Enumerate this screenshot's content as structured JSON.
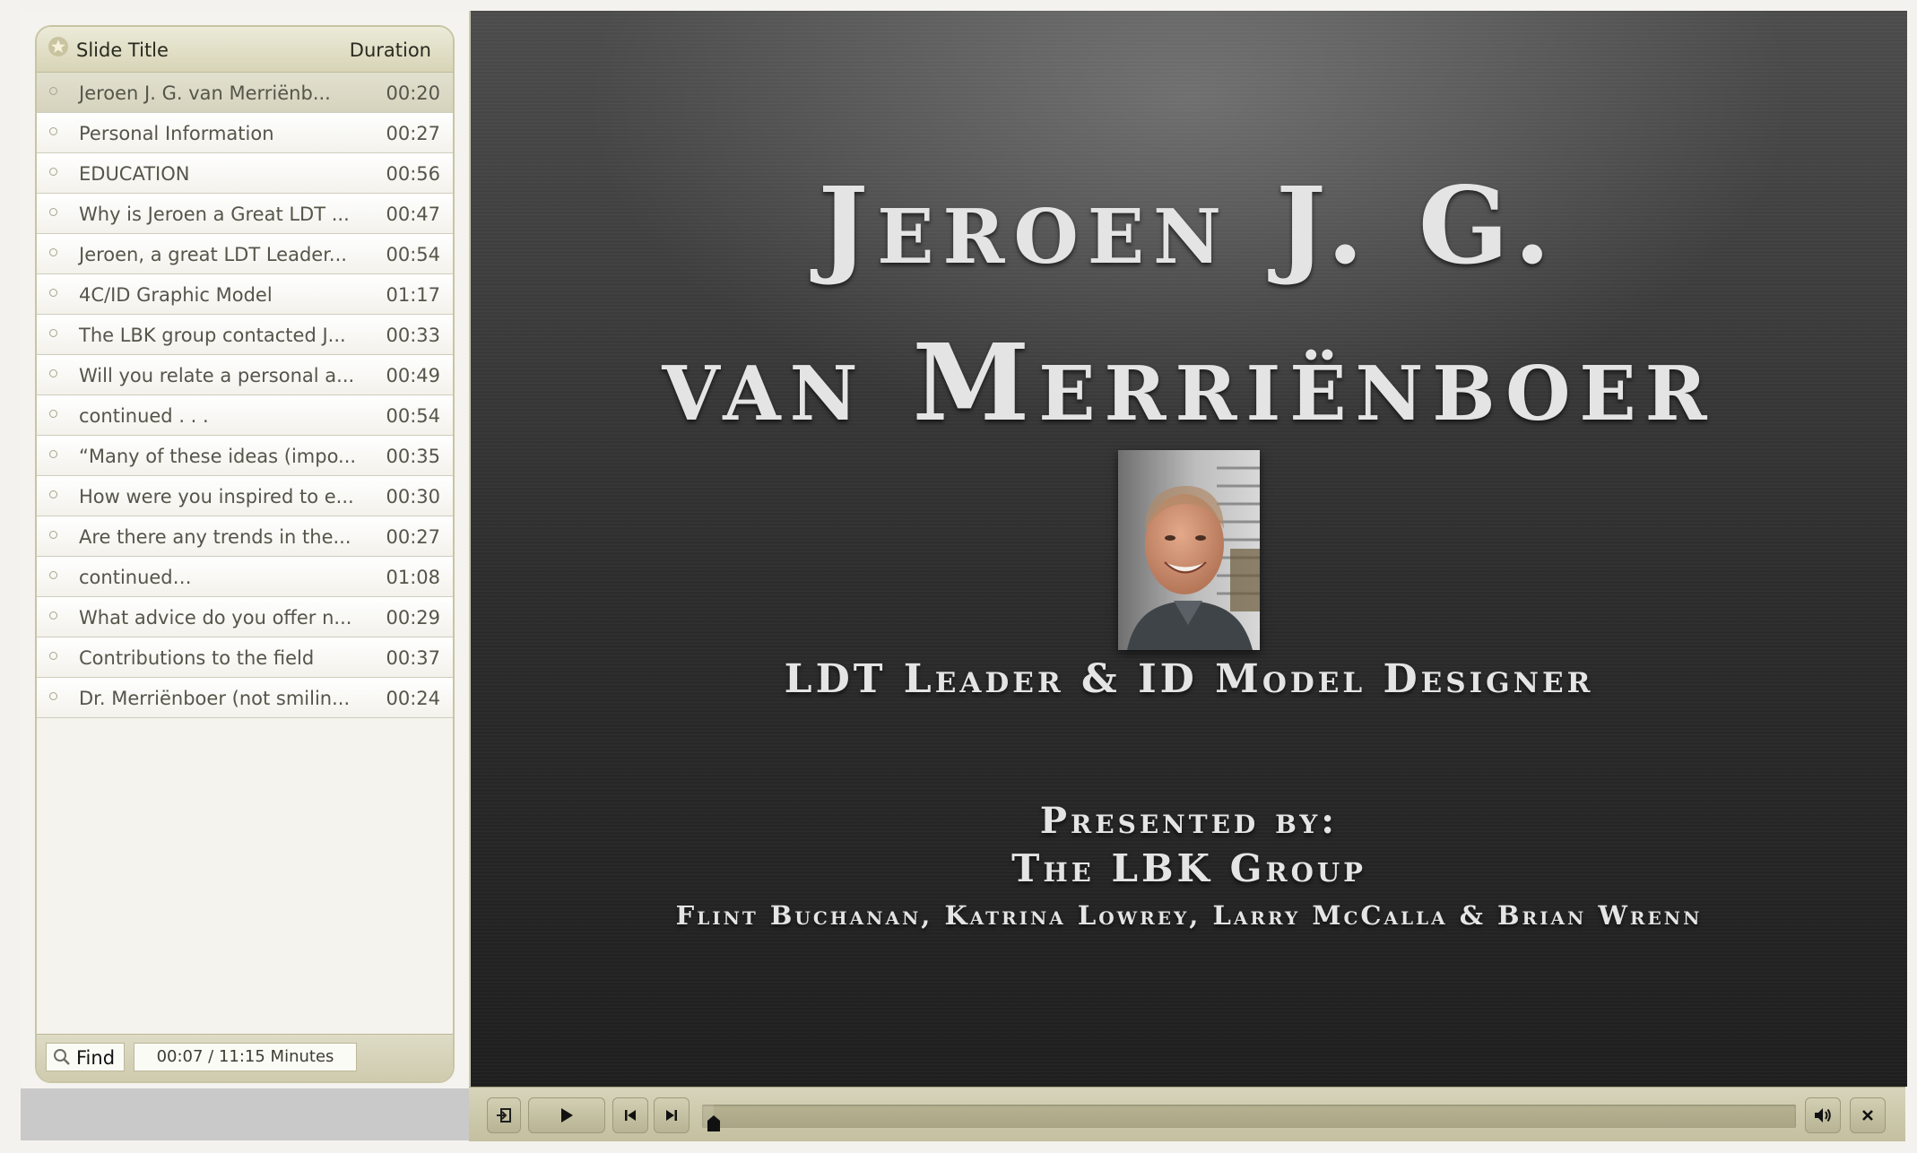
{
  "outline": {
    "header": {
      "title_label": "Slide Title",
      "duration_label": "Duration"
    },
    "slides": [
      {
        "title": "Jeroen J. G.  van Merriënb...",
        "duration": "00:20",
        "active": true
      },
      {
        "title": "Personal Information",
        "duration": "00:27"
      },
      {
        "title": "EDUCATION",
        "duration": "00:56"
      },
      {
        "title": "Why is Jeroen a Great LDT ...",
        "duration": "00:47"
      },
      {
        "title": "Jeroen, a great LDT Leader...",
        "duration": "00:54"
      },
      {
        "title": "4C/ID Graphic Model",
        "duration": "01:17"
      },
      {
        "title": "The LBK group contacted J...",
        "duration": "00:33"
      },
      {
        "title": "Will you relate a personal a...",
        "duration": "00:49"
      },
      {
        "title": "continued . . .",
        "duration": "00:54"
      },
      {
        "title": "“Many of these ideas (impo...",
        "duration": "00:35"
      },
      {
        "title": "How were you inspired to e...",
        "duration": "00:30"
      },
      {
        "title": "Are there any trends in the...",
        "duration": "00:27"
      },
      {
        "title": "continued…",
        "duration": "01:08"
      },
      {
        "title": "What advice do you offer n...",
        "duration": "00:29"
      },
      {
        "title": "Contributions to the field",
        "duration": "00:37"
      },
      {
        "title": "Dr. Merriënboer (not smilin...",
        "duration": "00:24"
      }
    ],
    "footer": {
      "find_label": "Find",
      "time_readout": "00:07 / 11:15 Minutes"
    }
  },
  "slide": {
    "title_line_1": "Jeroen J. G.",
    "title_line_2": "van Merriënboer",
    "subtitle": "LDT Leader & ID Model Designer",
    "presented_by": "Presented by:",
    "group": "The LBK Group",
    "authors": "Flint Buchanan, Katrina Lowrey, Larry McCalla & Brian Wrenn"
  },
  "player": {
    "progress_fraction": 0.0104,
    "icons": {
      "exit": "exit-icon",
      "play": "play-icon",
      "previous": "previous-slide-icon",
      "next": "next-slide-icon",
      "volume": "volume-icon",
      "close": "close-icon"
    }
  },
  "colors": {
    "panel_accent": "#d7d4b6",
    "slide_background": "#2c2c2c",
    "slide_text": "#e4e4e4"
  }
}
